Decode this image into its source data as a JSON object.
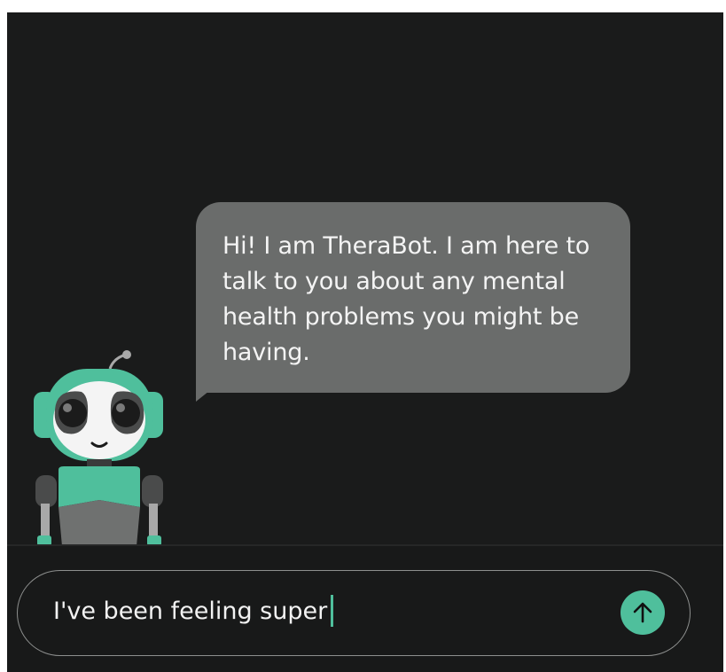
{
  "chat": {
    "messages": [
      {
        "sender": "TheraBot",
        "text": "Hi! I am TheraBot. I am here to talk to you about any mental health problems you might be having."
      }
    ]
  },
  "composer": {
    "value": "I've been feeling super",
    "send_icon": "arrow-up-icon"
  },
  "colors": {
    "background": "#1a1b1b",
    "bubble": "#6a6c6b",
    "accent": "#4fbf9c"
  }
}
